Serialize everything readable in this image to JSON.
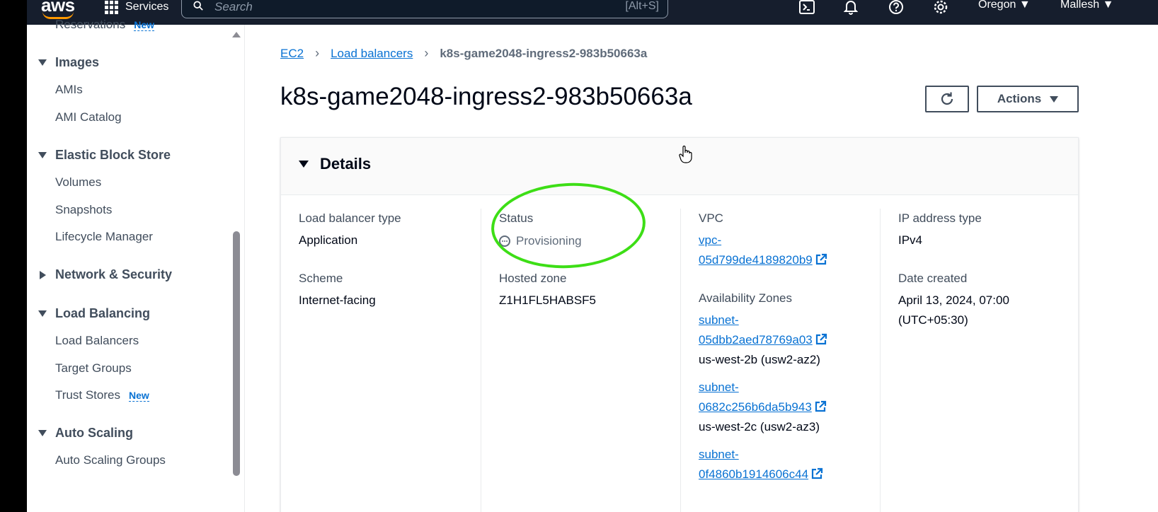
{
  "topbar": {
    "logo": "aws",
    "services_label": "Services",
    "search_placeholder": "Search",
    "search_shortcut": "[Alt+S]",
    "region": "Oregon ▼",
    "user": "Mallesh ▼"
  },
  "sidebar": {
    "partial_item": "Reservations",
    "partial_badge": "New",
    "sections": [
      {
        "label": "Images",
        "expanded": true,
        "items": [
          {
            "label": "AMIs"
          },
          {
            "label": "AMI Catalog"
          }
        ]
      },
      {
        "label": "Elastic Block Store",
        "expanded": true,
        "items": [
          {
            "label": "Volumes"
          },
          {
            "label": "Snapshots"
          },
          {
            "label": "Lifecycle Manager"
          }
        ]
      },
      {
        "label": "Network & Security",
        "expanded": false,
        "items": []
      },
      {
        "label": "Load Balancing",
        "expanded": true,
        "items": [
          {
            "label": "Load Balancers"
          },
          {
            "label": "Target Groups"
          },
          {
            "label": "Trust Stores",
            "badge": "New"
          }
        ]
      },
      {
        "label": "Auto Scaling",
        "expanded": true,
        "items": [
          {
            "label": "Auto Scaling Groups"
          }
        ]
      }
    ]
  },
  "breadcrumb": {
    "root": "EC2",
    "parent": "Load balancers",
    "current": "k8s-game2048-ingress2-983b50663a"
  },
  "page": {
    "title": "k8s-game2048-ingress2-983b50663a",
    "actions_label": "Actions"
  },
  "details": {
    "header": "Details",
    "lb_type_label": "Load balancer type",
    "lb_type_value": "Application",
    "scheme_label": "Scheme",
    "scheme_value": "Internet-facing",
    "status_label": "Status",
    "status_value": "Provisioning",
    "hosted_zone_label": "Hosted zone",
    "hosted_zone_value": "Z1H1FL5HABSF5",
    "vpc_label": "VPC",
    "vpc_line1": "vpc-",
    "vpc_line2": "05d799de4189820b9",
    "az_label": "Availability Zones",
    "subnets": [
      {
        "line1": "subnet-",
        "line2": "05dbb2aed78769a03",
        "zone": "us-west-2b (usw2-az2)"
      },
      {
        "line1": "subnet-",
        "line2": "0682c256b6da5b943",
        "zone": "us-west-2c (usw2-az3)"
      },
      {
        "line1": "subnet-",
        "line2": "0f4860b1914606c44",
        "zone": ""
      }
    ],
    "ip_type_label": "IP address type",
    "ip_type_value": "IPv4",
    "date_label": "Date created",
    "date_line1": "April 13, 2024, 07:00",
    "date_line2": "(UTC+05:30)"
  },
  "colors": {
    "topbar_bg": "#161e2d",
    "link": "#0972d3",
    "annotation": "#3dde16",
    "accent_orange": "#ff9900"
  }
}
